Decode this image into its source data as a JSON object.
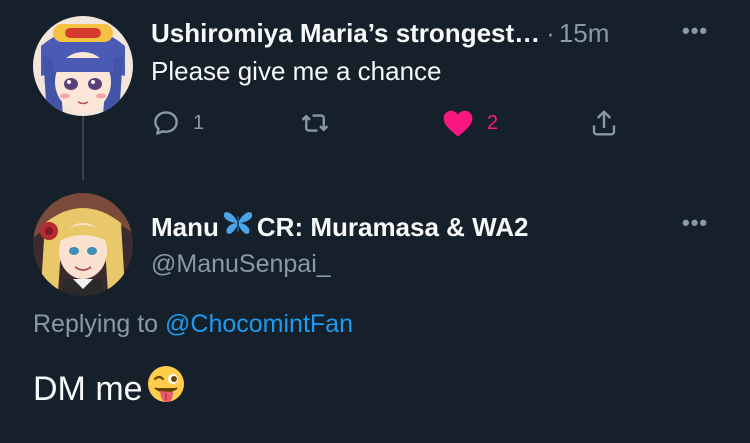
{
  "tweet_parent": {
    "display_name": "Ushiromiya Maria’s strongest…",
    "separator": "·",
    "time": "15m",
    "text": "Please give me a chance",
    "reply_count": "1",
    "like_count": "2",
    "liked": true
  },
  "tweet_main": {
    "display_name_part1": "Manu",
    "display_name_part2": "CR: Muramasa & WA2",
    "handle": "@ManuSenpai_",
    "replying_prefix": "Replying to",
    "replying_to": "@ChocomintFan",
    "text": "DM me"
  },
  "colors": {
    "background": "#15202b",
    "secondary_text": "#8b98a5",
    "link": "#1d9bf0",
    "like": "#f91880"
  }
}
